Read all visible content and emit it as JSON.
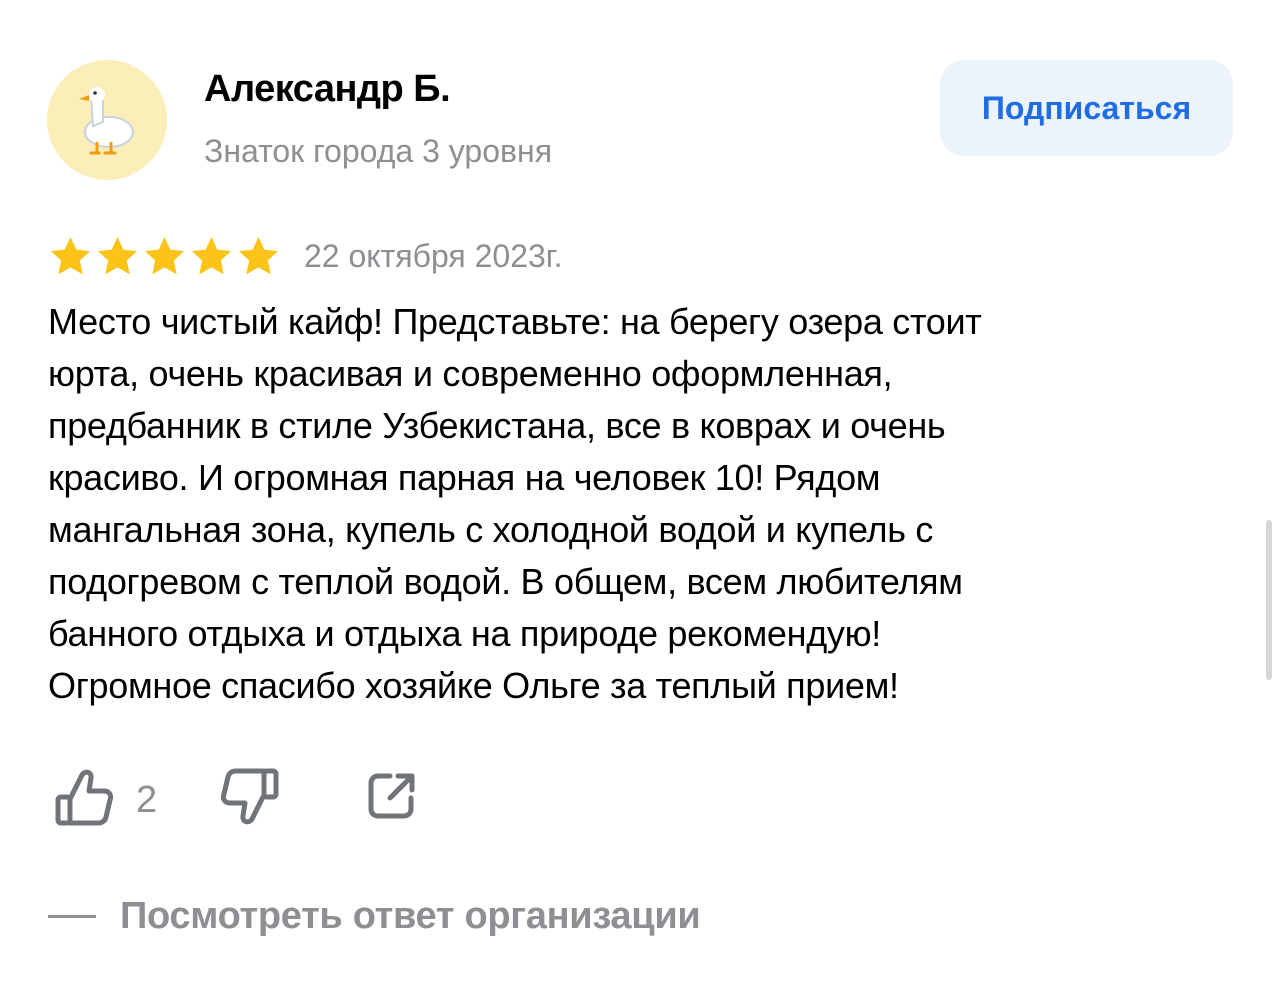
{
  "author": {
    "name": "Александр Б.",
    "level": "Знаток города 3 уровня",
    "avatar_icon": "goose-icon",
    "avatar_bg": "#fbeeb8"
  },
  "subscribe": {
    "label": "Подписаться",
    "color": "#1e6de5",
    "bg": "#edf3fb"
  },
  "review": {
    "rating": 5,
    "rating_max": 5,
    "star_color": "#fcc419",
    "date": "22 октября 2023г.",
    "text": "Место чистый кайф! Представьте: на берегу озера стоит\nюрта, очень красивая и современно оформленная,\nпредбанник в стиле Узбекистана, все в коврах и очень\nкрасиво. И огромная парная на человек 10! Рядом\nмангальная зона, купель с холодной водой и купель с\nподогревом с теплой водой. В общем, всем любителям\nбанного отдыха и отдыха на природе рекомендую!\nОгромное спасибо хозяйке Ольге за теплый прием!"
  },
  "actions": {
    "like_icon": "thumbs-up-icon",
    "like_count": "2",
    "dislike_icon": "thumbs-down-icon",
    "share_icon": "share-icon"
  },
  "org_reply": {
    "label": "Посмотреть ответ организации"
  }
}
